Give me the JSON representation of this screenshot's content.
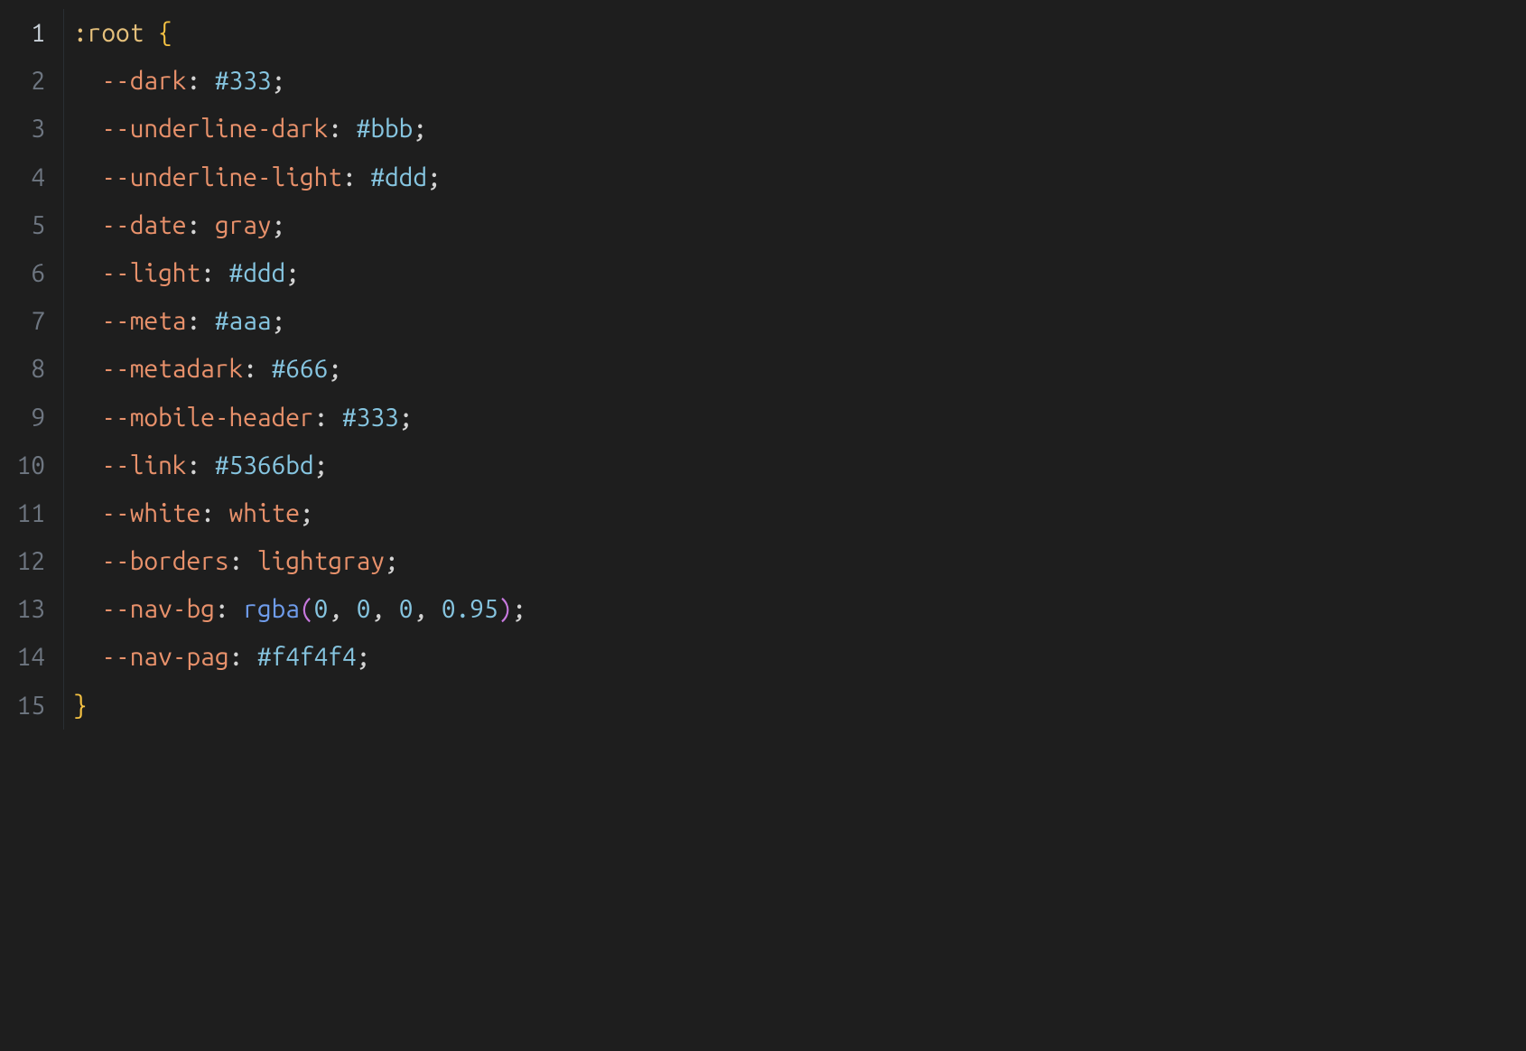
{
  "code": {
    "selector": ":root",
    "open_brace": "{",
    "close_brace": "}",
    "indent": "  ",
    "lines": [
      {
        "prop": "--dark",
        "kind": "hex",
        "value": "#333"
      },
      {
        "prop": "--underline-dark",
        "kind": "hex",
        "value": "#bbb"
      },
      {
        "prop": "--underline-light",
        "kind": "hex",
        "value": "#ddd"
      },
      {
        "prop": "--date",
        "kind": "ident",
        "value": "gray"
      },
      {
        "prop": "--light",
        "kind": "hex",
        "value": "#ddd"
      },
      {
        "prop": "--meta",
        "kind": "hex",
        "value": "#aaa"
      },
      {
        "prop": "--metadark",
        "kind": "hex",
        "value": "#666"
      },
      {
        "prop": "--mobile-header",
        "kind": "hex",
        "value": "#333"
      },
      {
        "prop": "--link",
        "kind": "hex",
        "value": "#5366bd"
      },
      {
        "prop": "--white",
        "kind": "ident",
        "value": "white"
      },
      {
        "prop": "--borders",
        "kind": "ident",
        "value": "lightgray"
      },
      {
        "prop": "--nav-bg",
        "kind": "func",
        "func": "rgba",
        "args": [
          "0",
          "0",
          "0",
          "0.95"
        ]
      },
      {
        "prop": "--nav-pag",
        "kind": "hex",
        "value": "#f4f4f4"
      }
    ],
    "line_numbers": [
      "1",
      "2",
      "3",
      "4",
      "5",
      "6",
      "7",
      "8",
      "9",
      "10",
      "11",
      "12",
      "13",
      "14",
      "15"
    ]
  }
}
